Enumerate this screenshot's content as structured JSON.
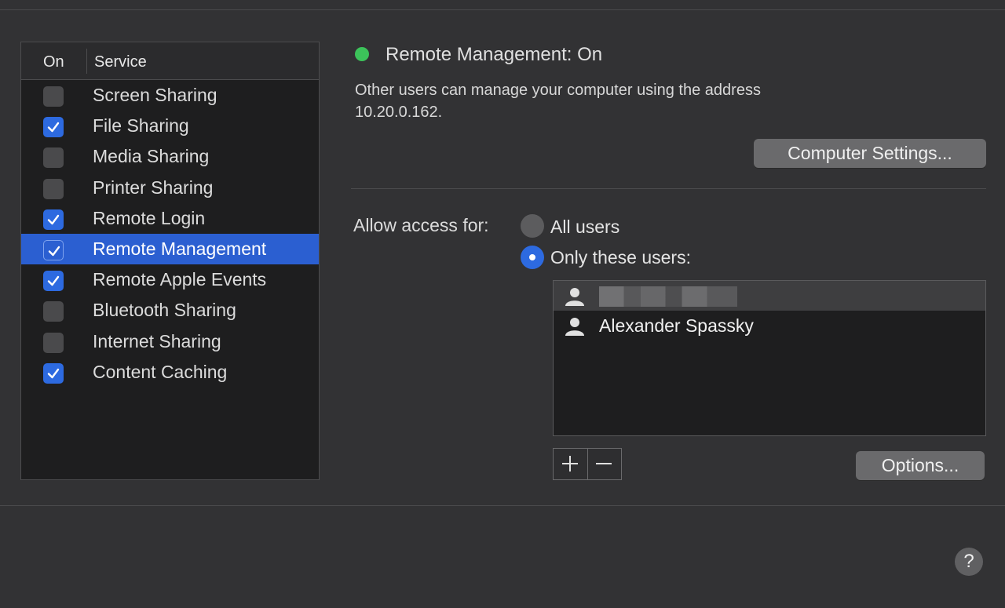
{
  "services_table": {
    "header": {
      "on_label": "On",
      "service_label": "Service"
    },
    "rows": [
      {
        "label": "Screen Sharing",
        "checked": false
      },
      {
        "label": "File Sharing",
        "checked": true
      },
      {
        "label": "Media Sharing",
        "checked": false
      },
      {
        "label": "Printer Sharing",
        "checked": false
      },
      {
        "label": "Remote Login",
        "checked": true
      },
      {
        "label": "Remote Management",
        "checked": true,
        "selected": true
      },
      {
        "label": "Remote Apple Events",
        "checked": true
      },
      {
        "label": "Bluetooth Sharing",
        "checked": false
      },
      {
        "label": "Internet Sharing",
        "checked": false
      },
      {
        "label": "Content Caching",
        "checked": true
      }
    ]
  },
  "status": {
    "title": "Remote Management: On",
    "indicator_color": "#3cc35a",
    "description_line1": "Other users can manage your computer using the address",
    "description_line2": "10.20.0.162."
  },
  "computer_settings_button": "Computer Settings...",
  "access": {
    "label": "Allow access for:",
    "option_all": "All users",
    "option_only": "Only these users:",
    "selected": "only"
  },
  "users": [
    {
      "name": "",
      "redacted": true,
      "highlighted": true
    },
    {
      "name": "Alexander Spassky",
      "redacted": false,
      "highlighted": false
    }
  ],
  "options_button": "Options...",
  "help_button": "?",
  "icons": {
    "checkbox": "checkmark-icon",
    "user": "person-icon",
    "add": "plus-icon",
    "remove": "minus-icon"
  },
  "colors": {
    "accent": "#2d6ae0",
    "selection": "#2b5fd1"
  }
}
